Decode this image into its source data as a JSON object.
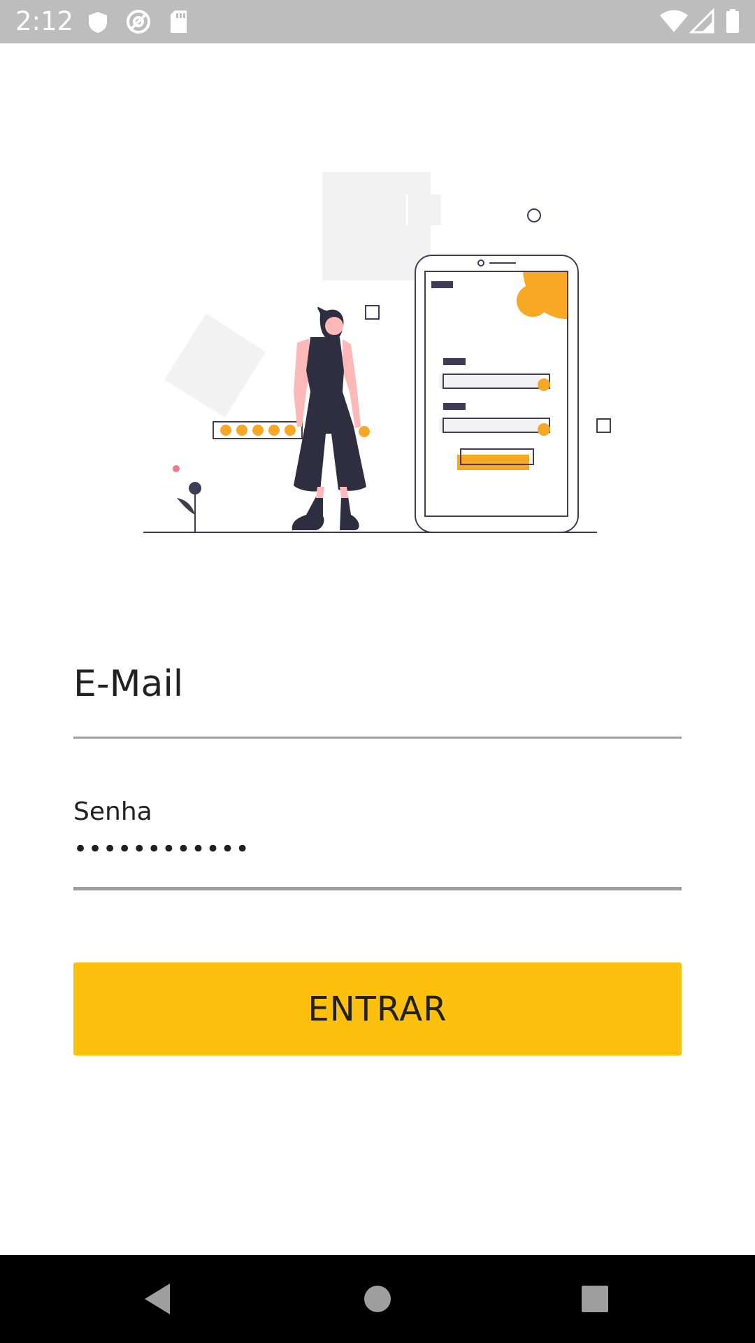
{
  "status_bar": {
    "time": "2:12",
    "icons": [
      "shield-icon",
      "at-sign-icon",
      "sd-card-icon",
      "wifi-icon",
      "cell-signal-icon",
      "battery-icon"
    ]
  },
  "illustration": {
    "name": "login-illustration",
    "colors": {
      "accent": "#f9a826",
      "dark": "#3f3d56",
      "light": "#f2f2f2",
      "skin": "#ffb8b8"
    }
  },
  "form": {
    "email": {
      "label": "E-Mail",
      "value": ""
    },
    "password": {
      "label": "Senha",
      "value": "••••••••••••"
    },
    "submit_label": "ENTRAR"
  },
  "nav_bar": {
    "buttons": [
      "back-icon",
      "home-icon",
      "recents-icon"
    ]
  },
  "colors": {
    "status_bar": "#bdbdbd",
    "button": "#fdc00d",
    "underline": "#9e9e9e",
    "nav_bar": "#000000"
  }
}
